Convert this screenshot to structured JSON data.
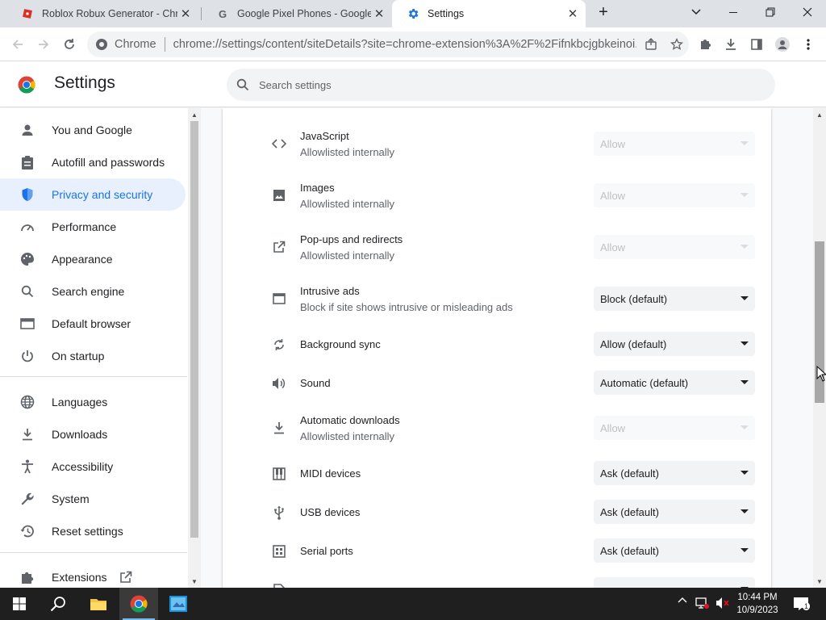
{
  "tabs": [
    {
      "title": "Roblox Robux Generator - Chrom",
      "favicon": "roblox-icon",
      "active": false
    },
    {
      "title": "Google Pixel Phones - Google St",
      "favicon": "google-icon",
      "active": false
    },
    {
      "title": "Settings",
      "favicon": "gear-icon",
      "active": true
    }
  ],
  "omnibox": {
    "chip_label": "Chrome",
    "url": "chrome://settings/content/siteDetails?site=chrome-extension%3A%2F%2Fifnkbcjgbkeinoi..."
  },
  "header": {
    "title": "Settings",
    "search_placeholder": "Search settings"
  },
  "nav": {
    "items": [
      {
        "label": "You and Google",
        "icon": "person-icon"
      },
      {
        "label": "Autofill and passwords",
        "icon": "clipboard-icon"
      },
      {
        "label": "Privacy and security",
        "icon": "shield-icon",
        "selected": true
      },
      {
        "label": "Performance",
        "icon": "speedometer-icon"
      },
      {
        "label": "Appearance",
        "icon": "palette-icon"
      },
      {
        "label": "Search engine",
        "icon": "search-icon"
      },
      {
        "label": "Default browser",
        "icon": "browser-icon"
      },
      {
        "label": "On startup",
        "icon": "power-icon"
      },
      {
        "label": "Languages",
        "icon": "globe-icon"
      },
      {
        "label": "Downloads",
        "icon": "download-icon"
      },
      {
        "label": "Accessibility",
        "icon": "accessibility-icon"
      },
      {
        "label": "System",
        "icon": "wrench-icon"
      },
      {
        "label": "Reset settings",
        "icon": "history-icon"
      },
      {
        "label": "Extensions",
        "icon": "puzzle-icon"
      }
    ]
  },
  "permissions": [
    {
      "label": "JavaScript",
      "sub": "Allowlisted internally",
      "value": "Allow",
      "disabled": true,
      "icon": "code-icon"
    },
    {
      "label": "Images",
      "sub": "Allowlisted internally",
      "value": "Allow",
      "disabled": true,
      "icon": "image-icon"
    },
    {
      "label": "Pop-ups and redirects",
      "sub": "Allowlisted internally",
      "value": "Allow",
      "disabled": true,
      "icon": "open-in-new-icon"
    },
    {
      "label": "Intrusive ads",
      "sub": "Block if site shows intrusive or misleading ads",
      "value": "Block (default)",
      "disabled": false,
      "icon": "ad-window-icon"
    },
    {
      "label": "Background sync",
      "sub": "",
      "value": "Allow (default)",
      "disabled": false,
      "icon": "sync-icon"
    },
    {
      "label": "Sound",
      "sub": "",
      "value": "Automatic (default)",
      "disabled": false,
      "icon": "speaker-icon"
    },
    {
      "label": "Automatic downloads",
      "sub": "Allowlisted internally",
      "value": "Allow",
      "disabled": true,
      "icon": "download-icon"
    },
    {
      "label": "MIDI devices",
      "sub": "",
      "value": "Ask (default)",
      "disabled": false,
      "icon": "piano-icon"
    },
    {
      "label": "USB devices",
      "sub": "",
      "value": "Ask (default)",
      "disabled": false,
      "icon": "usb-icon"
    },
    {
      "label": "Serial ports",
      "sub": "",
      "value": "Ask (default)",
      "disabled": false,
      "icon": "serial-port-icon"
    }
  ],
  "taskbar": {
    "time": "10:44 PM",
    "date": "10/9/2023",
    "notification_count": "1"
  }
}
